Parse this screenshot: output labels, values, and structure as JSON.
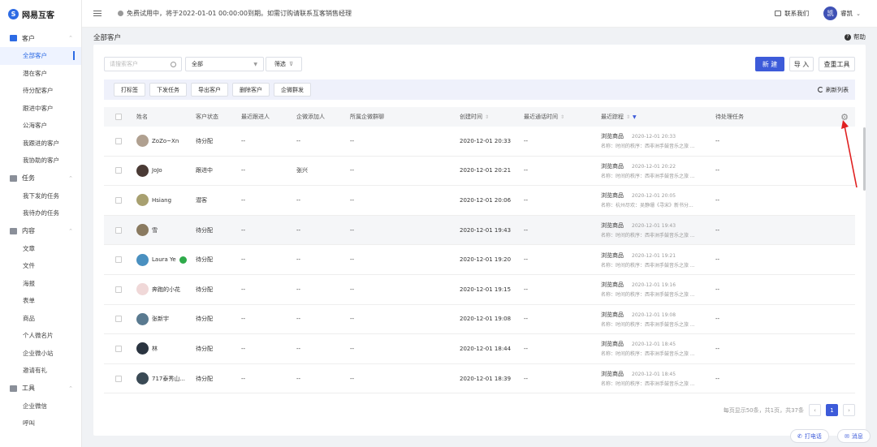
{
  "app": {
    "logo_char": "S",
    "name": "网易互客"
  },
  "header": {
    "trial_notice": "免费试用中，将于2022-01-01 00:00:00到期。如需订购请联系互客销售经理",
    "contact_label": "联系我们",
    "user_avatar": "凯",
    "user_name": "睿凯"
  },
  "sidebar": {
    "groups": [
      {
        "label": "客户",
        "icon": "customer-icon",
        "items": [
          "全部客户",
          "潜在客户",
          "待分配客户",
          "跟进中客户",
          "公海客户",
          "我跟进的客户",
          "我协助的客户"
        ]
      },
      {
        "label": "任务",
        "icon": "task-icon",
        "items": [
          "我下发的任务",
          "我待办的任务"
        ]
      },
      {
        "label": "内容",
        "icon": "content-icon",
        "items": [
          "文章",
          "文件",
          "海报",
          "表单",
          "商品",
          "个人微名片",
          "企业微小站",
          "邀请有礼"
        ]
      },
      {
        "label": "工具",
        "icon": "tool-icon",
        "items": [
          "企业微信",
          "呼叫"
        ]
      }
    ],
    "active_item": "全部客户"
  },
  "page": {
    "title": "全部客户",
    "help": "帮助"
  },
  "toolbar": {
    "search_placeholder": "请搜索客户",
    "select_value": "全部",
    "filter_label": "筛选",
    "new_label": "新 建",
    "import_label": "导 入",
    "dedupe_label": "查重工具"
  },
  "actions": {
    "buttons": [
      "打标签",
      "下发任务",
      "导出客户",
      "删除客户",
      "企微群发"
    ],
    "refresh_label": "刷新列表"
  },
  "table": {
    "columns": [
      "姓名",
      "客户状态",
      "最近跟进人",
      "企微添加人",
      "所属企微群聊",
      "创建时间",
      "最近通话时间",
      "最近踪程",
      "待处理任务"
    ],
    "rows": [
      {
        "name": "ZoZo~Xn",
        "status": "待分配",
        "follower": "--",
        "added_by": "--",
        "group": "--",
        "created": "2020-12-01 20:33",
        "last_call": "--",
        "track_title": "浏览商品",
        "track_time": "2020-12-01 20:33",
        "track_desc": "名称：时间的秩序：西非洲手鼓音乐之旅 ...",
        "task": "--",
        "avatar_color": "#b0a090"
      },
      {
        "name": "JoJo",
        "status": "跟进中",
        "follower": "--",
        "added_by": "张兴",
        "group": "--",
        "created": "2020-12-01 20:21",
        "last_call": "--",
        "track_title": "浏览商品",
        "track_time": "2020-12-01 20:22",
        "track_desc": "名称：时间的秩序：西非洲手鼓音乐之旅 ...",
        "task": "--",
        "avatar_color": "#4a3a35"
      },
      {
        "name": "Hsiang",
        "status": "潜客",
        "follower": "--",
        "added_by": "--",
        "group": "--",
        "created": "2020-12-01 20:06",
        "last_call": "--",
        "track_title": "浏览商品",
        "track_time": "2020-12-01 20:05",
        "track_desc": "名称：杭州尽欢：吴静珊《寻宋》新书分...",
        "task": "--",
        "avatar_color": "#a8a070"
      },
      {
        "name": "雪",
        "status": "待分配",
        "follower": "--",
        "added_by": "--",
        "group": "--",
        "created": "2020-12-01 19:43",
        "last_call": "--",
        "track_title": "浏览商品",
        "track_time": "2020-12-01 19:43",
        "track_desc": "名称：时间的秩序：西非洲手鼓音乐之旅 ...",
        "task": "--",
        "avatar_color": "#8a7a60"
      },
      {
        "name": "Laura Ye",
        "status": "待分配",
        "follower": "--",
        "added_by": "--",
        "group": "--",
        "created": "2020-12-01 19:20",
        "last_call": "--",
        "track_title": "浏览商品",
        "track_time": "2020-12-01 19:21",
        "track_desc": "名称：时间的秩序：西非洲手鼓音乐之旅 ...",
        "task": "--",
        "avatar_color": "#4a90c0"
      },
      {
        "name": "奔跑的小花",
        "status": "待分配",
        "follower": "--",
        "added_by": "--",
        "group": "--",
        "created": "2020-12-01 19:15",
        "last_call": "--",
        "track_title": "浏览商品",
        "track_time": "2020-12-01 19:16",
        "track_desc": "名称：时间的秩序：西非洲手鼓音乐之旅 ...",
        "task": "--",
        "avatar_color": "#f0d8d8"
      },
      {
        "name": "张新宇",
        "status": "待分配",
        "follower": "--",
        "added_by": "--",
        "group": "--",
        "created": "2020-12-01 19:08",
        "last_call": "--",
        "track_title": "浏览商品",
        "track_time": "2020-12-01 19:08",
        "track_desc": "名称：时间的秩序：西非洲手鼓音乐之旅 ...",
        "task": "--",
        "avatar_color": "#5a7a90"
      },
      {
        "name": "林",
        "status": "待分配",
        "follower": "--",
        "added_by": "--",
        "group": "--",
        "created": "2020-12-01 18:44",
        "last_call": "--",
        "track_title": "浏览商品",
        "track_time": "2020-12-01 18:45",
        "track_desc": "名称：时间的秩序：西非洲手鼓音乐之旅 ...",
        "task": "--",
        "avatar_color": "#2a3440"
      },
      {
        "name": "717泰秀山...",
        "status": "待分配",
        "follower": "--",
        "added_by": "--",
        "group": "--",
        "created": "2020-12-01 18:39",
        "last_call": "--",
        "track_title": "浏览商品",
        "track_time": "2020-12-01 18:45",
        "track_desc": "名称：时间的秩序：西非洲手鼓音乐之旅 ...",
        "task": "--",
        "avatar_color": "#3a4a55"
      }
    ],
    "highlighted_row": 3
  },
  "pagination": {
    "summary": "每页显示50条，共1页，共37条",
    "prev": "‹",
    "current": "1",
    "next": "›"
  },
  "floating": {
    "call_label": "打电话",
    "message_label": "消息"
  }
}
